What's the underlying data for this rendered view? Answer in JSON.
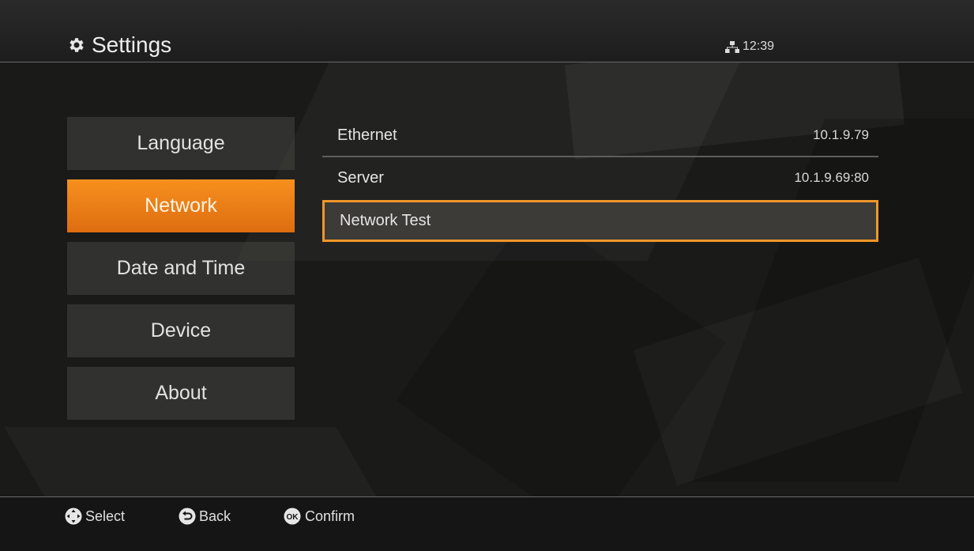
{
  "header": {
    "title": "Settings",
    "icon": "gear-icon",
    "network_icon": "network-icon",
    "clock": "12:39"
  },
  "menu": {
    "items": [
      {
        "label": "Language",
        "active": false
      },
      {
        "label": "Network",
        "active": true
      },
      {
        "label": "Date and Time",
        "active": false
      },
      {
        "label": "Device",
        "active": false
      },
      {
        "label": "About",
        "active": false
      }
    ]
  },
  "network": {
    "rows": [
      {
        "label": "Ethernet",
        "value": "10.1.9.79"
      },
      {
        "label": "Server",
        "value": "10.1.9.69:80"
      },
      {
        "label": "Network Test",
        "value": "",
        "selected": true
      }
    ]
  },
  "footer": {
    "select_label": "Select",
    "back_label": "Back",
    "confirm_label": "Confirm",
    "ok_badge": "OK"
  },
  "colors": {
    "accent": "#f0962a",
    "active_menu": "#f7901e",
    "background": "#1a1a19"
  }
}
